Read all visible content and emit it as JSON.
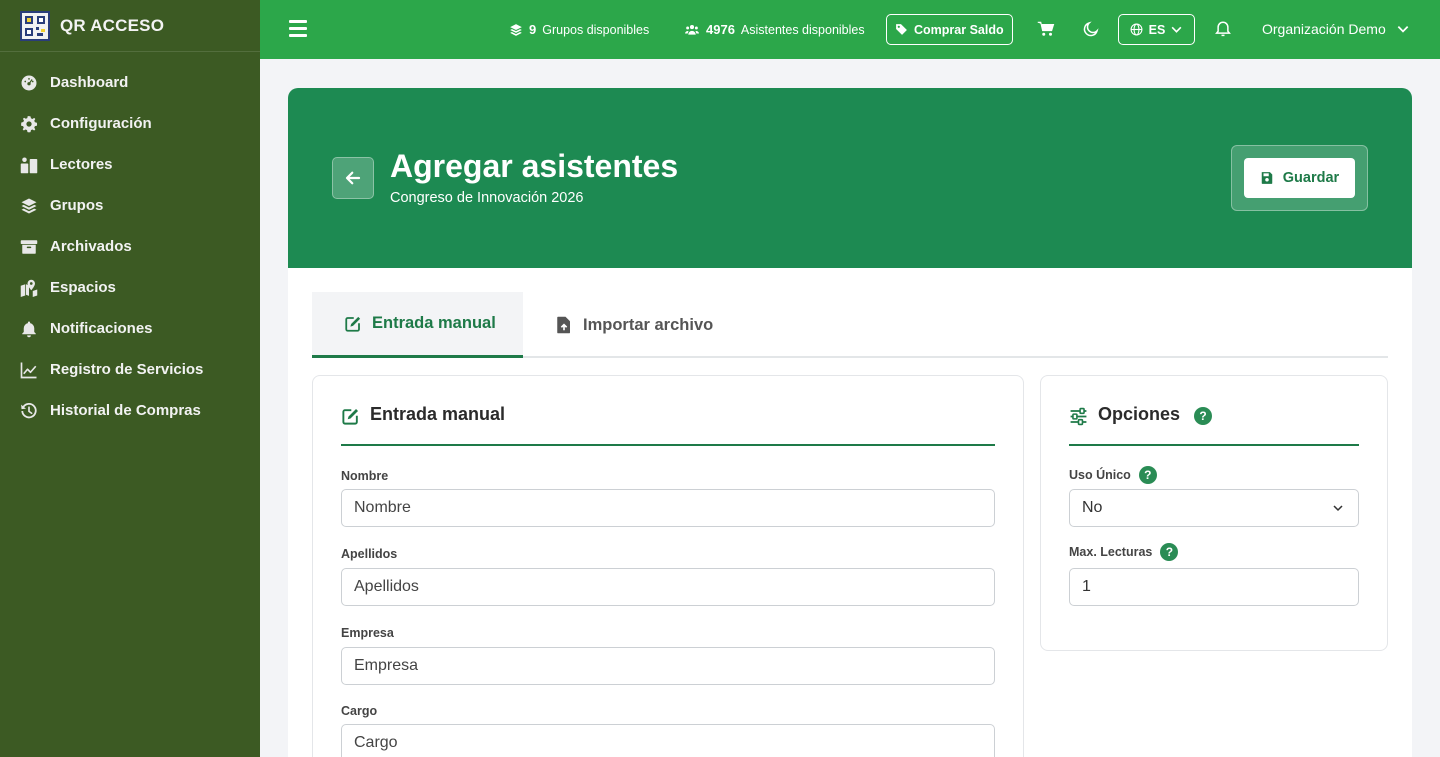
{
  "app": {
    "name": "QR ACCESO"
  },
  "sidebar": {
    "items": [
      {
        "label": "Dashboard",
        "icon": "dashboard-gauge-icon"
      },
      {
        "label": "Configuración",
        "icon": "gear-icon"
      },
      {
        "label": "Lectores",
        "icon": "readers-icon"
      },
      {
        "label": "Grupos",
        "icon": "layers-icon"
      },
      {
        "label": "Archivados",
        "icon": "archive-box-icon"
      },
      {
        "label": "Espacios",
        "icon": "map-location-icon"
      },
      {
        "label": "Notificaciones",
        "icon": "bell-icon"
      },
      {
        "label": "Registro de Servicios",
        "icon": "line-chart-icon"
      },
      {
        "label": "Historial de Compras",
        "icon": "history-icon"
      }
    ]
  },
  "topbar": {
    "groups_count": "9",
    "groups_label": "Grupos disponibles",
    "attendees_count": "4976",
    "attendees_label": "Asistentes disponibles",
    "buy_label": "Comprar Saldo",
    "lang": "ES",
    "org": "Organización Demo"
  },
  "header": {
    "title": "Agregar asistentes",
    "subtitle": "Congreso de Innovación 2026",
    "save_label": "Guardar"
  },
  "tabs": [
    {
      "label": "Entrada manual",
      "active": true
    },
    {
      "label": "Importar archivo",
      "active": false
    }
  ],
  "manual": {
    "title": "Entrada manual",
    "fields": [
      {
        "label": "Nombre",
        "placeholder": "Nombre"
      },
      {
        "label": "Apellidos",
        "placeholder": "Apellidos"
      },
      {
        "label": "Empresa",
        "placeholder": "Empresa"
      },
      {
        "label": "Cargo",
        "placeholder": "Cargo"
      }
    ]
  },
  "options": {
    "title": "Opciones",
    "single_use_label": "Uso Único",
    "single_use_value": "No",
    "max_reads_label": "Max. Lecturas",
    "max_reads_value": "1",
    "help_glyph": "?"
  },
  "colors": {
    "sidebar": "#3c5a23",
    "topbar": "#2ca74a",
    "hero": "#1d8a52",
    "accent": "#1e7a48"
  }
}
